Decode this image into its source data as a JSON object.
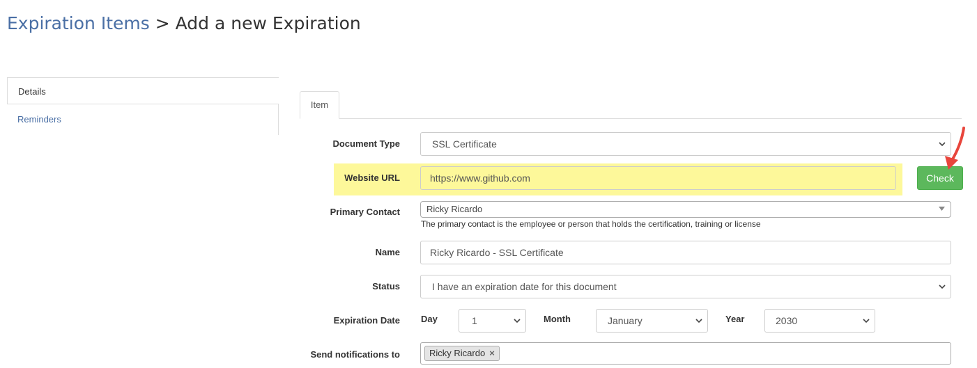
{
  "breadcrumb": {
    "parent": "Expiration Items",
    "separator": ">",
    "current": "Add a new Expiration"
  },
  "sidebar": {
    "items": [
      {
        "label": "Details"
      },
      {
        "label": "Reminders"
      }
    ]
  },
  "tabs": [
    {
      "label": "Item"
    }
  ],
  "form": {
    "document_type": {
      "label": "Document Type",
      "value": "SSL Certificate"
    },
    "website_url": {
      "label": "Website URL",
      "value": "https://www.github.com"
    },
    "check_button": "Check",
    "primary_contact": {
      "label": "Primary Contact",
      "value": "Ricky Ricardo",
      "help": "The primary contact is the employee or person that holds the certification, training or license"
    },
    "name": {
      "label": "Name",
      "value": "Ricky Ricardo - SSL Certificate"
    },
    "status": {
      "label": "Status",
      "value": "I have an expiration date for this document"
    },
    "expiration_date": {
      "label": "Expiration Date",
      "day_label": "Day",
      "day_value": "1",
      "month_label": "Month",
      "month_value": "January",
      "year_label": "Year",
      "year_value": "2030"
    },
    "send_notifications": {
      "label": "Send notifications to",
      "tags": [
        "Ricky Ricardo"
      ],
      "remove_glyph": "×"
    }
  },
  "colors": {
    "link": "#4a6fa5",
    "highlight": "#fdf89a",
    "check_button": "#5cb85c",
    "arrow": "#e8453c"
  }
}
